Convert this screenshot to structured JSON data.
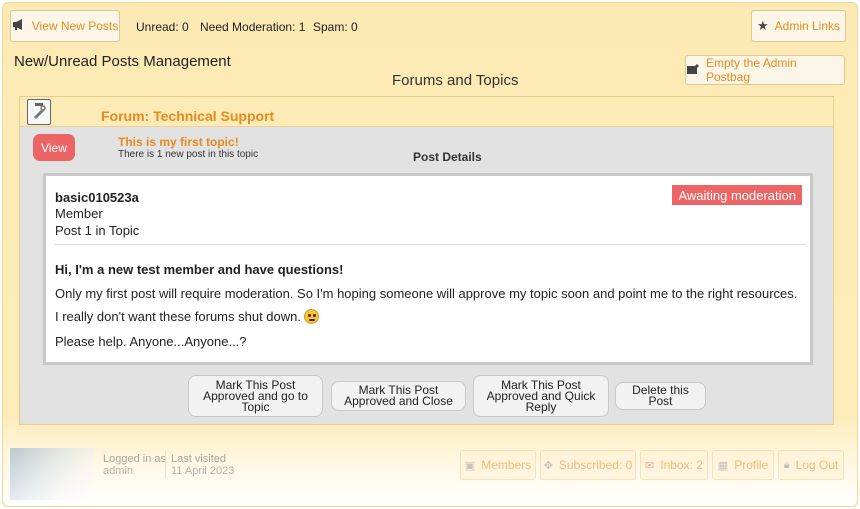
{
  "topbar": {
    "view_new_posts": "View New Posts",
    "unread": "Unread: 0",
    "need_moderation": "Need Moderation: 1",
    "spam": "Spam: 0",
    "admin_links": "Admin Links"
  },
  "page": {
    "title": "New/Unread Posts Management",
    "subtitle": "Forums and Topics",
    "empty_postbag": "Empty the Admin Postbag"
  },
  "forum": {
    "title": "Forum: Technical Support",
    "view_button": "View",
    "topic_title": "This is my first topic!",
    "topic_info": "There is 1 new post in this topic",
    "post_details_label": "Post Details"
  },
  "post": {
    "author": "basic010523a",
    "role": "Member",
    "post_number": "Post 1 in Topic",
    "status_badge": "Awaiting moderation",
    "heading": "Hi, I'm a new test member and have questions!",
    "line1": "Only my first post will require moderation. So I'm hoping someone will approve my topic soon and point me to the right resources.",
    "line2": "I really don't want these forums shut down.",
    "line3": "Please help. Anyone...Anyone...?"
  },
  "actions": {
    "approve_goto_1": "Mark This Post",
    "approve_goto_2": "Approved and go to",
    "approve_goto_3": "Topic",
    "approve_close_1": "Mark This Post",
    "approve_close_2": "Approved and Close",
    "approve_reply_1": "Mark This Post",
    "approve_reply_2": "Approved and Quick",
    "approve_reply_3": "Reply",
    "delete": "Delete this Post"
  },
  "footer": {
    "logged_in_as_label": "Logged in as",
    "logged_in_as_value": "admin",
    "last_visited_label": "Last visited",
    "last_visited_value": "11 April 2023",
    "members": "Members",
    "subscribed": "Subscribed: 0",
    "inbox": "Inbox: 2",
    "profile": "Profile",
    "logout": "Log Out"
  },
  "colors": {
    "accent_orange": "#e98a1c",
    "badge_red": "#ec6464",
    "panel_yellow": "#fdebb7"
  }
}
